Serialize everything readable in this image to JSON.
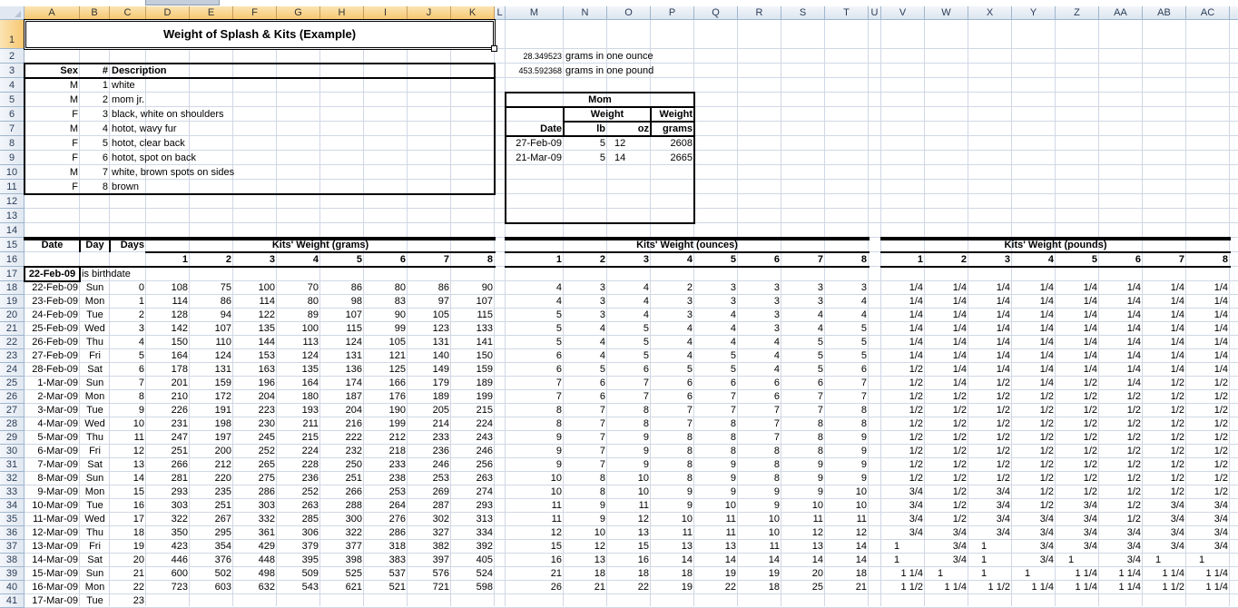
{
  "columns": [
    "A",
    "B",
    "C",
    "D",
    "E",
    "F",
    "G",
    "H",
    "I",
    "J",
    "K",
    "L",
    "M",
    "N",
    "O",
    "P",
    "Q",
    "R",
    "S",
    "T",
    "U",
    "V",
    "W",
    "X",
    "Y",
    "Z",
    "AA",
    "AB",
    "AC"
  ],
  "title": "Weight of Splash & Kits (Example)",
  "conversions": [
    {
      "value": "28.349523",
      "label": "grams in one ounce"
    },
    {
      "value": "453.592368",
      "label": "grams in one pound"
    }
  ],
  "kit_table": {
    "headers": {
      "sex": "Sex",
      "num": "#",
      "description": "Description"
    },
    "rows": [
      {
        "sex": "M",
        "num": "1",
        "description": "white"
      },
      {
        "sex": "M",
        "num": "2",
        "description": "mom jr."
      },
      {
        "sex": "F",
        "num": "3",
        "description": "black, white on shoulders"
      },
      {
        "sex": "M",
        "num": "4",
        "description": "hotot, wavy fur"
      },
      {
        "sex": "F",
        "num": "5",
        "description": "hotot, clear back"
      },
      {
        "sex": "F",
        "num": "6",
        "description": "hotot, spot on back"
      },
      {
        "sex": "M",
        "num": "7",
        "description": "white, brown spots on sides"
      },
      {
        "sex": "F",
        "num": "8",
        "description": "brown"
      }
    ]
  },
  "mom": {
    "title": "Mom",
    "weight_label": "Weight",
    "weight_label2": "Weight",
    "date_label": "Date",
    "lb_label": "lb",
    "oz_label": "oz",
    "grams_label": "grams",
    "rows": [
      {
        "date": "27-Feb-09",
        "lb": "5",
        "oz": "12",
        "grams": "2608"
      },
      {
        "date": "21-Mar-09",
        "lb": "5",
        "oz": "14",
        "grams": "2665"
      }
    ]
  },
  "weights": {
    "date_label": "Date",
    "day_label": "Day",
    "days_label": "Days",
    "grams_title": "Kits' Weight (grams)",
    "ounces_title": "Kits' Weight (ounces)",
    "pounds_title": "Kits' Weight (pounds)",
    "kit_numbers": [
      "1",
      "2",
      "3",
      "4",
      "5",
      "6",
      "7",
      "8"
    ],
    "birthdate": "22-Feb-09",
    "birthdate_note": "is birthdate",
    "rows": [
      {
        "date": "22-Feb-09",
        "day": "Sun",
        "days": "0",
        "g": [
          "108",
          "75",
          "100",
          "70",
          "86",
          "80",
          "86",
          "90"
        ],
        "oz": [
          "4",
          "3",
          "4",
          "2",
          "3",
          "3",
          "3",
          "3"
        ],
        "lb": [
          "1/4",
          "1/4",
          "1/4",
          "1/4",
          "1/4",
          "1/4",
          "1/4",
          "1/4"
        ]
      },
      {
        "date": "23-Feb-09",
        "day": "Mon",
        "days": "1",
        "g": [
          "114",
          "86",
          "114",
          "80",
          "98",
          "83",
          "97",
          "107"
        ],
        "oz": [
          "4",
          "3",
          "4",
          "3",
          "3",
          "3",
          "3",
          "4"
        ],
        "lb": [
          "1/4",
          "1/4",
          "1/4",
          "1/4",
          "1/4",
          "1/4",
          "1/4",
          "1/4"
        ]
      },
      {
        "date": "24-Feb-09",
        "day": "Tue",
        "days": "2",
        "g": [
          "128",
          "94",
          "122",
          "89",
          "107",
          "90",
          "105",
          "115"
        ],
        "oz": [
          "5",
          "3",
          "4",
          "3",
          "4",
          "3",
          "4",
          "4"
        ],
        "lb": [
          "1/4",
          "1/4",
          "1/4",
          "1/4",
          "1/4",
          "1/4",
          "1/4",
          "1/4"
        ]
      },
      {
        "date": "25-Feb-09",
        "day": "Wed",
        "days": "3",
        "g": [
          "142",
          "107",
          "135",
          "100",
          "115",
          "99",
          "123",
          "133"
        ],
        "oz": [
          "5",
          "4",
          "5",
          "4",
          "4",
          "3",
          "4",
          "5"
        ],
        "lb": [
          "1/4",
          "1/4",
          "1/4",
          "1/4",
          "1/4",
          "1/4",
          "1/4",
          "1/4"
        ]
      },
      {
        "date": "26-Feb-09",
        "day": "Thu",
        "days": "4",
        "g": [
          "150",
          "110",
          "144",
          "113",
          "124",
          "105",
          "131",
          "141"
        ],
        "oz": [
          "5",
          "4",
          "5",
          "4",
          "4",
          "4",
          "5",
          "5"
        ],
        "lb": [
          "1/4",
          "1/4",
          "1/4",
          "1/4",
          "1/4",
          "1/4",
          "1/4",
          "1/4"
        ]
      },
      {
        "date": "27-Feb-09",
        "day": "Fri",
        "days": "5",
        "g": [
          "164",
          "124",
          "153",
          "124",
          "131",
          "121",
          "140",
          "150"
        ],
        "oz": [
          "6",
          "4",
          "5",
          "4",
          "5",
          "4",
          "5",
          "5"
        ],
        "lb": [
          "1/4",
          "1/4",
          "1/4",
          "1/4",
          "1/4",
          "1/4",
          "1/4",
          "1/4"
        ]
      },
      {
        "date": "28-Feb-09",
        "day": "Sat",
        "days": "6",
        "g": [
          "178",
          "131",
          "163",
          "135",
          "136",
          "125",
          "149",
          "159"
        ],
        "oz": [
          "6",
          "5",
          "6",
          "5",
          "5",
          "4",
          "5",
          "6"
        ],
        "lb": [
          "1/2",
          "1/4",
          "1/4",
          "1/4",
          "1/4",
          "1/4",
          "1/4",
          "1/4"
        ]
      },
      {
        "date": "1-Mar-09",
        "day": "Sun",
        "days": "7",
        "g": [
          "201",
          "159",
          "196",
          "164",
          "174",
          "166",
          "179",
          "189"
        ],
        "oz": [
          "7",
          "6",
          "7",
          "6",
          "6",
          "6",
          "6",
          "7"
        ],
        "lb": [
          "1/2",
          "1/4",
          "1/2",
          "1/4",
          "1/2",
          "1/4",
          "1/2",
          "1/2"
        ]
      },
      {
        "date": "2-Mar-09",
        "day": "Mon",
        "days": "8",
        "g": [
          "210",
          "172",
          "204",
          "180",
          "187",
          "176",
          "189",
          "199"
        ],
        "oz": [
          "7",
          "6",
          "7",
          "6",
          "7",
          "6",
          "7",
          "7"
        ],
        "lb": [
          "1/2",
          "1/2",
          "1/2",
          "1/2",
          "1/2",
          "1/2",
          "1/2",
          "1/2"
        ]
      },
      {
        "date": "3-Mar-09",
        "day": "Tue",
        "days": "9",
        "g": [
          "226",
          "191",
          "223",
          "193",
          "204",
          "190",
          "205",
          "215"
        ],
        "oz": [
          "8",
          "7",
          "8",
          "7",
          "7",
          "7",
          "7",
          "8"
        ],
        "lb": [
          "1/2",
          "1/2",
          "1/2",
          "1/2",
          "1/2",
          "1/2",
          "1/2",
          "1/2"
        ]
      },
      {
        "date": "4-Mar-09",
        "day": "Wed",
        "days": "10",
        "g": [
          "231",
          "198",
          "230",
          "211",
          "216",
          "199",
          "214",
          "224"
        ],
        "oz": [
          "8",
          "7",
          "8",
          "7",
          "8",
          "7",
          "8",
          "8"
        ],
        "lb": [
          "1/2",
          "1/2",
          "1/2",
          "1/2",
          "1/2",
          "1/2",
          "1/2",
          "1/2"
        ]
      },
      {
        "date": "5-Mar-09",
        "day": "Thu",
        "days": "11",
        "g": [
          "247",
          "197",
          "245",
          "215",
          "222",
          "212",
          "233",
          "243"
        ],
        "oz": [
          "9",
          "7",
          "9",
          "8",
          "8",
          "7",
          "8",
          "9"
        ],
        "lb": [
          "1/2",
          "1/2",
          "1/2",
          "1/2",
          "1/2",
          "1/2",
          "1/2",
          "1/2"
        ]
      },
      {
        "date": "6-Mar-09",
        "day": "Fri",
        "days": "12",
        "g": [
          "251",
          "200",
          "252",
          "224",
          "232",
          "218",
          "236",
          "246"
        ],
        "oz": [
          "9",
          "7",
          "9",
          "8",
          "8",
          "8",
          "8",
          "9"
        ],
        "lb": [
          "1/2",
          "1/2",
          "1/2",
          "1/2",
          "1/2",
          "1/2",
          "1/2",
          "1/2"
        ]
      },
      {
        "date": "7-Mar-09",
        "day": "Sat",
        "days": "13",
        "g": [
          "266",
          "212",
          "265",
          "228",
          "250",
          "233",
          "246",
          "256"
        ],
        "oz": [
          "9",
          "7",
          "9",
          "8",
          "9",
          "8",
          "9",
          "9"
        ],
        "lb": [
          "1/2",
          "1/2",
          "1/2",
          "1/2",
          "1/2",
          "1/2",
          "1/2",
          "1/2"
        ]
      },
      {
        "date": "8-Mar-09",
        "day": "Sun",
        "days": "14",
        "g": [
          "281",
          "220",
          "275",
          "236",
          "251",
          "238",
          "253",
          "263"
        ],
        "oz": [
          "10",
          "8",
          "10",
          "8",
          "9",
          "8",
          "9",
          "9"
        ],
        "lb": [
          "1/2",
          "1/2",
          "1/2",
          "1/2",
          "1/2",
          "1/2",
          "1/2",
          "1/2"
        ]
      },
      {
        "date": "9-Mar-09",
        "day": "Mon",
        "days": "15",
        "g": [
          "293",
          "235",
          "286",
          "252",
          "266",
          "253",
          "269",
          "274"
        ],
        "oz": [
          "10",
          "8",
          "10",
          "9",
          "9",
          "9",
          "9",
          "10"
        ],
        "lb": [
          "3/4",
          "1/2",
          "3/4",
          "1/2",
          "1/2",
          "1/2",
          "1/2",
          "1/2"
        ]
      },
      {
        "date": "10-Mar-09",
        "day": "Tue",
        "days": "16",
        "g": [
          "303",
          "251",
          "303",
          "263",
          "288",
          "264",
          "287",
          "293"
        ],
        "oz": [
          "11",
          "9",
          "11",
          "9",
          "10",
          "9",
          "10",
          "10"
        ],
        "lb": [
          "3/4",
          "1/2",
          "3/4",
          "1/2",
          "3/4",
          "1/2",
          "3/4",
          "3/4"
        ]
      },
      {
        "date": "11-Mar-09",
        "day": "Wed",
        "days": "17",
        "g": [
          "322",
          "267",
          "332",
          "285",
          "300",
          "276",
          "302",
          "313"
        ],
        "oz": [
          "11",
          "9",
          "12",
          "10",
          "11",
          "10",
          "11",
          "11"
        ],
        "lb": [
          "3/4",
          "1/2",
          "3/4",
          "3/4",
          "3/4",
          "1/2",
          "3/4",
          "3/4"
        ]
      },
      {
        "date": "12-Mar-09",
        "day": "Thu",
        "days": "18",
        "g": [
          "350",
          "295",
          "361",
          "306",
          "322",
          "286",
          "327",
          "334"
        ],
        "oz": [
          "12",
          "10",
          "13",
          "11",
          "11",
          "10",
          "12",
          "12"
        ],
        "lb": [
          "3/4",
          "3/4",
          "3/4",
          "3/4",
          "3/4",
          "3/4",
          "3/4",
          "3/4"
        ]
      },
      {
        "date": "13-Mar-09",
        "day": "Fri",
        "days": "19",
        "g": [
          "423",
          "354",
          "429",
          "379",
          "377",
          "318",
          "382",
          "392"
        ],
        "oz": [
          "15",
          "12",
          "15",
          "13",
          "13",
          "11",
          "13",
          "14"
        ],
        "lb": [
          "1",
          "3/4",
          "1",
          "3/4",
          "3/4",
          "3/4",
          "3/4",
          "3/4"
        ]
      },
      {
        "date": "14-Mar-09",
        "day": "Sat",
        "days": "20",
        "g": [
          "446",
          "376",
          "448",
          "395",
          "398",
          "383",
          "397",
          "405"
        ],
        "oz": [
          "16",
          "13",
          "16",
          "14",
          "14",
          "14",
          "14",
          "14"
        ],
        "lb": [
          "1",
          "3/4",
          "1",
          "3/4",
          "1",
          "3/4",
          "1",
          "1"
        ]
      },
      {
        "date": "15-Mar-09",
        "day": "Sun",
        "days": "21",
        "g": [
          "600",
          "502",
          "498",
          "509",
          "525",
          "537",
          "576",
          "524"
        ],
        "oz": [
          "21",
          "18",
          "18",
          "18",
          "19",
          "19",
          "20",
          "18"
        ],
        "lb": [
          "1 1/4",
          "1",
          "1",
          "1",
          "1 1/4",
          "1 1/4",
          "1 1/4",
          "1 1/4"
        ]
      },
      {
        "date": "16-Mar-09",
        "day": "Mon",
        "days": "22",
        "g": [
          "723",
          "603",
          "632",
          "543",
          "621",
          "521",
          "721",
          "598"
        ],
        "oz": [
          "26",
          "21",
          "22",
          "19",
          "22",
          "18",
          "25",
          "21"
        ],
        "lb": [
          "1 1/2",
          "1 1/4",
          "1 1/2",
          "1 1/4",
          "1 1/4",
          "1 1/4",
          "1 1/2",
          "1 1/4"
        ]
      },
      {
        "date": "17-Mar-09",
        "day": "Tue",
        "days": "23",
        "g": [],
        "oz": [],
        "lb": []
      }
    ]
  }
}
